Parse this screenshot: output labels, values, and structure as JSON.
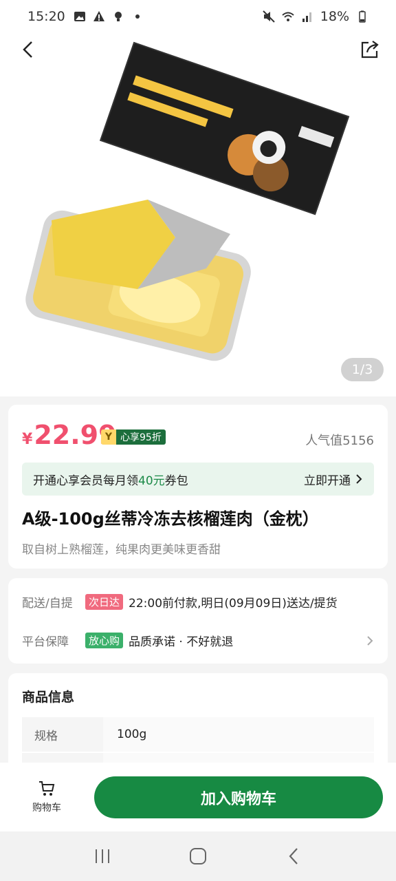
{
  "status_bar": {
    "time": "15:20",
    "battery": "18%"
  },
  "hero": {
    "pager": "1/3"
  },
  "price": {
    "currency": "¥",
    "value": "22.99",
    "member_badge": "心享95折",
    "popularity": "人气值5156"
  },
  "vip": {
    "text_prefix": "开通心享会员每月领",
    "amount": "40元",
    "text_suffix": "券包",
    "open_label": "立即开通"
  },
  "product": {
    "title": "A级-100g丝蒂冷冻去核榴莲肉（金枕）",
    "subtitle": "取自树上熟榴莲，纯果肉更美味更香甜"
  },
  "delivery": {
    "label": "配送/自提",
    "tag": "次日达",
    "text": "22:00前付款,明日(09月09日)送达/提货"
  },
  "guarantee": {
    "label": "平台保障",
    "tag": "放心购",
    "text": "品质承诺 · 不好就退"
  },
  "info": {
    "title": "商品信息",
    "spec_key": "规格",
    "spec_value": "100g"
  },
  "action_bar": {
    "cart_label": "购物车",
    "add_to_cart": "加入购物车"
  },
  "colors": {
    "price": "#f0506e",
    "primary_green": "#178a43",
    "vip_bg": "#e9f5ed"
  }
}
